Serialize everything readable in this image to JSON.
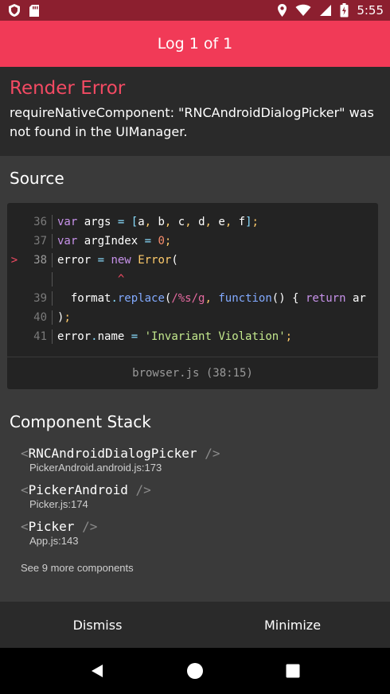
{
  "status_bar": {
    "time": "5:55",
    "icons": [
      "shield-icon",
      "sd-card-icon",
      "location-icon",
      "wifi-icon",
      "signal-icon",
      "battery-icon"
    ]
  },
  "header": {
    "title": "Log 1 of 1"
  },
  "error": {
    "title": "Render Error",
    "message": "requireNativeComponent: \"RNCAndroidDialogPicker\" was not found in the UIManager."
  },
  "source": {
    "title": "Source",
    "file": "browser.js (38:15)",
    "lines": [
      {
        "num": "36",
        "text": "var args = [a, b, c, d, e, f];"
      },
      {
        "num": "37",
        "text": "var argIndex = 0;"
      },
      {
        "num": "38",
        "text": "error = new Error(",
        "marker": ">"
      },
      {
        "num": "",
        "text": "         ^"
      },
      {
        "num": "39",
        "text": "  format.replace(/%s/g, function() { return ar"
      },
      {
        "num": "40",
        "text": ");"
      },
      {
        "num": "41",
        "text": "error.name = 'Invariant Violation';"
      }
    ]
  },
  "component_stack": {
    "title": "Component Stack",
    "items": [
      {
        "open": "<",
        "name": "RNCAndroidDialogPicker",
        "close": "/>",
        "location": "PickerAndroid.android.js:173"
      },
      {
        "open": "<",
        "name": "PickerAndroid",
        "close": "/>",
        "location": "Picker.js:174"
      },
      {
        "open": "<",
        "name": "Picker",
        "close": "/>",
        "location": "App.js:143"
      }
    ],
    "see_more": "See 9 more components"
  },
  "footer": {
    "dismiss": "Dismiss",
    "minimize": "Minimize"
  },
  "nav": {
    "icons": [
      "back-icon",
      "home-icon",
      "recents-icon"
    ]
  },
  "colors": {
    "status_bar": "#8c1f2f",
    "header": "#f13a57",
    "error_title": "#f34a63",
    "panel": "#2a2a2a",
    "body": "#3a3a3a",
    "code_bg": "#232323"
  }
}
